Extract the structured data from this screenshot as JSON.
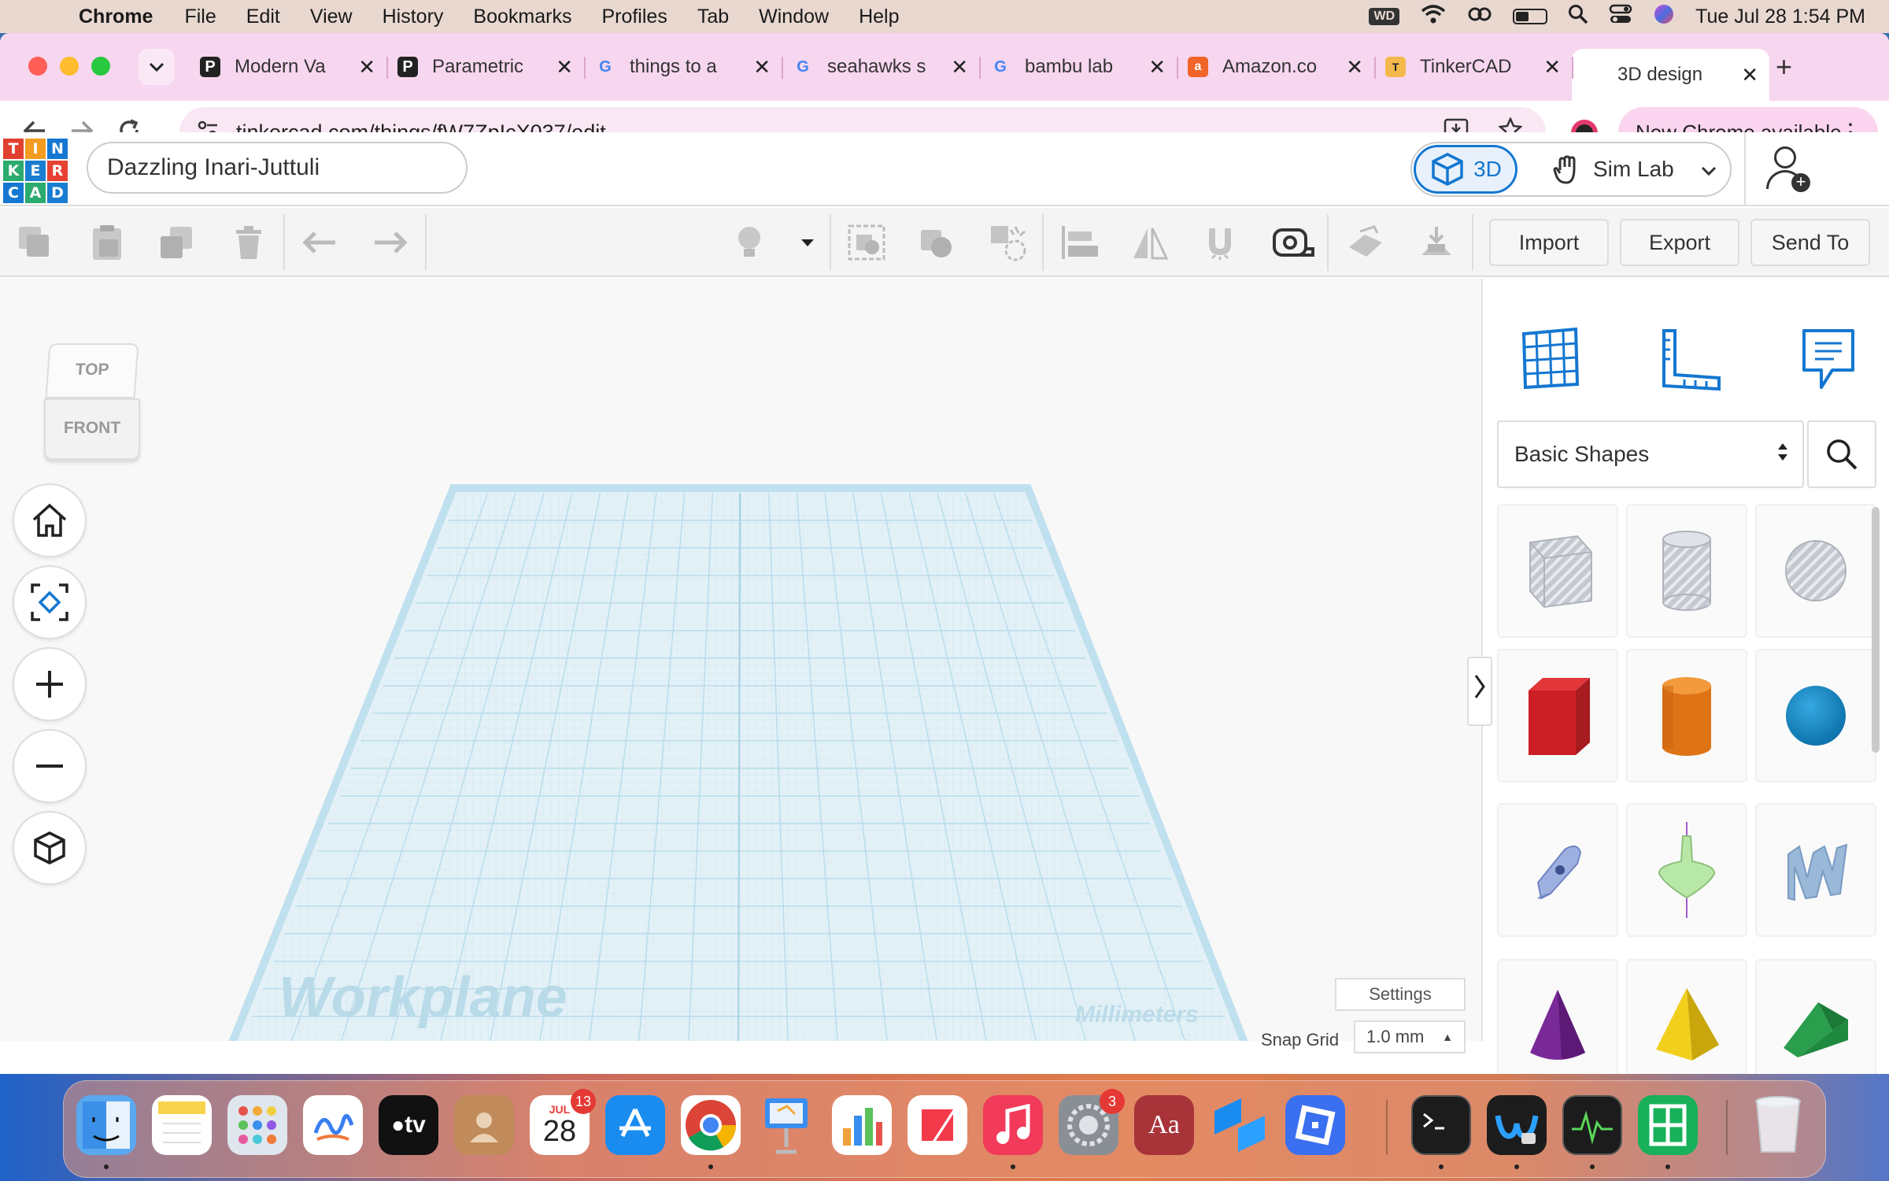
{
  "menubar": {
    "app_name": "Chrome",
    "items": [
      "File",
      "Edit",
      "View",
      "History",
      "Bookmarks",
      "Profiles",
      "Tab",
      "Window",
      "Help"
    ],
    "wd_label": "WD",
    "datetime": "Tue Jul 28  1:54 PM"
  },
  "tabs": [
    {
      "title": "Modern Va",
      "icon": "printables-icon"
    },
    {
      "title": "Parametric",
      "icon": "printables-icon"
    },
    {
      "title": "things to a",
      "icon": "google-icon"
    },
    {
      "title": "seahawks s",
      "icon": "google-icon"
    },
    {
      "title": "bambu lab",
      "icon": "google-icon"
    },
    {
      "title": "Amazon.co",
      "icon": "amazon-icon"
    },
    {
      "title": "TinkerCAD",
      "icon": "tinkercad-icon"
    },
    {
      "title": "3D design",
      "icon": "tinkercad-grid-icon",
      "active": true
    }
  ],
  "addressbar": {
    "url": "tinkercad.com/things/fW7ZpIcX037/edit",
    "new_chrome": "New Chrome available"
  },
  "tinkercad": {
    "logo": [
      "T",
      "I",
      "N",
      "K",
      "E",
      "R",
      "C",
      "A",
      "D"
    ],
    "project_name": "Dazzling Inari-Juttuli",
    "mode_3d": "3D",
    "mode_simlab": "Sim Lab",
    "import": "Import",
    "export": "Export",
    "send_to": "Send To"
  },
  "viewport": {
    "viewcube_top": "TOP",
    "viewcube_front": "FRONT",
    "workplane_label": "Workplane",
    "units_label": "Millimeters",
    "settings": "Settings",
    "snap_grid_label": "Snap Grid",
    "snap_grid_value": "1.0 mm"
  },
  "panel": {
    "shape_category": "Basic Shapes",
    "shapes": [
      "hole-box",
      "hole-cylinder",
      "hole-sphere",
      "box",
      "cylinder",
      "sphere",
      "scribble",
      "shape-generator",
      "text",
      "cone",
      "pyramid",
      "roof"
    ]
  },
  "dock": {
    "calendar_month": "JUL",
    "calendar_day": "28",
    "calendar_badge": "13",
    "settings_badge": "3",
    "dictionary_label": "Aa",
    "tv_label": "tv"
  },
  "colors": {
    "menubar": "#e8d8d0",
    "tabstrip": "#f7d6ef",
    "omnibox": "#f9e7f3",
    "tinkercad_blue": "#1477d1",
    "workplane_grid": "#bfe3f0"
  }
}
